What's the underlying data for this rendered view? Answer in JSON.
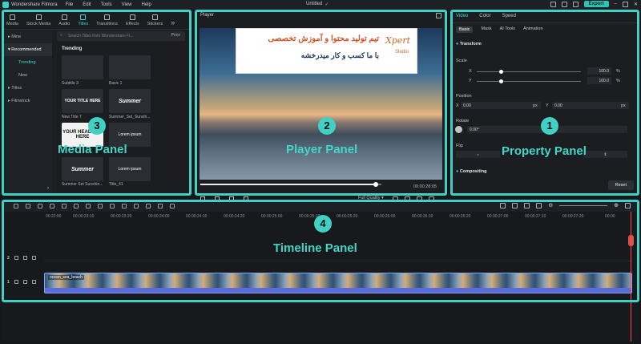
{
  "titlebar": {
    "app_name": "Wondershare Filmora",
    "menu": [
      "File",
      "Edit",
      "Tools",
      "View",
      "Help"
    ],
    "project_title": "Untitled",
    "export_label": "Export"
  },
  "media": {
    "tabs": [
      "Media",
      "Stock Media",
      "Audio",
      "Titles",
      "Transitions",
      "Effects",
      "Stickers"
    ],
    "active_tab": "Titles",
    "sidebar": {
      "mine": "Mine",
      "recommended": "Recommended",
      "trending": "Trending",
      "new": "New",
      "titles": "Titles",
      "filmstock": "Filmstock"
    },
    "search_placeholder": "Search Titles from Wondershare Fi...",
    "sort_label": "Price",
    "section_title": "Trending",
    "items": [
      {
        "label": "Subtitle 3",
        "preview": ""
      },
      {
        "label": "Basic 1",
        "preview": ""
      },
      {
        "label": "New Title 7",
        "preview": "YOUR TITLE HERE"
      },
      {
        "label": "Summer_Set_Sunshi...",
        "preview": "Summer"
      },
      {
        "label": "",
        "preview": "YOUR HEADLINE HERE"
      },
      {
        "label": "",
        "preview": "Lorem ipsum"
      },
      {
        "label": "Summer Set Sunshin...",
        "preview": "Summer"
      },
      {
        "label": "Title_41",
        "preview": "Lorem ipsum"
      }
    ],
    "caption": "Media Panel",
    "number": "3"
  },
  "player": {
    "title": "Player",
    "banner_line1": "تیم تولید محتوا و آموزش تخصصی",
    "banner_line2": "با ما کسب و کار میدرخشه",
    "brand": "Xpert",
    "brand_sub": "Studio",
    "time": "00:00:28:05",
    "quality": "Full Quality",
    "progress": 0.97,
    "caption": "Player Panel",
    "number": "2"
  },
  "property": {
    "tabs": [
      "Video",
      "Color",
      "Speed"
    ],
    "subtabs": [
      "Basic",
      "Mask",
      "AI Tools",
      "Animation"
    ],
    "transform": "Transform",
    "scale": "Scale",
    "scale_x_label": "X",
    "scale_x": "100.0",
    "scale_y_label": "Y",
    "scale_y": "100.0",
    "scale_unit": "%",
    "position": "Position",
    "pos_x_label": "X",
    "pos_x": "0.00",
    "pos_y_label": "Y",
    "pos_y": "0.00",
    "px_unit": "px",
    "rotate": "Rotate",
    "rotate_value": "0.00°",
    "flip": "Flip",
    "compositing": "Compositing",
    "reset": "Reset",
    "caption": "Property Panel",
    "number": "1"
  },
  "timeline": {
    "ruler": [
      "00:22:00",
      "00:00:23:10",
      "00:00:23:20",
      "00:00:24:00",
      "00:00:24:10",
      "00:00:24:20",
      "00:00:25:00",
      "00:00:25:10",
      "00:00:25:20",
      "00:00:26:00",
      "00:00:26:10",
      "00:00:26:20",
      "00:00:27:00",
      "00:00:27:10",
      "00:00:27:20",
      "00:00"
    ],
    "clip_name": "ocean_sea_beach",
    "track_labels": [
      "2",
      "1"
    ],
    "caption": "Timeline Panel",
    "number": "4"
  },
  "colors": {
    "accent": "#3fd1c4",
    "export": "#29c6b8",
    "playhead": "#ff4d4d"
  }
}
